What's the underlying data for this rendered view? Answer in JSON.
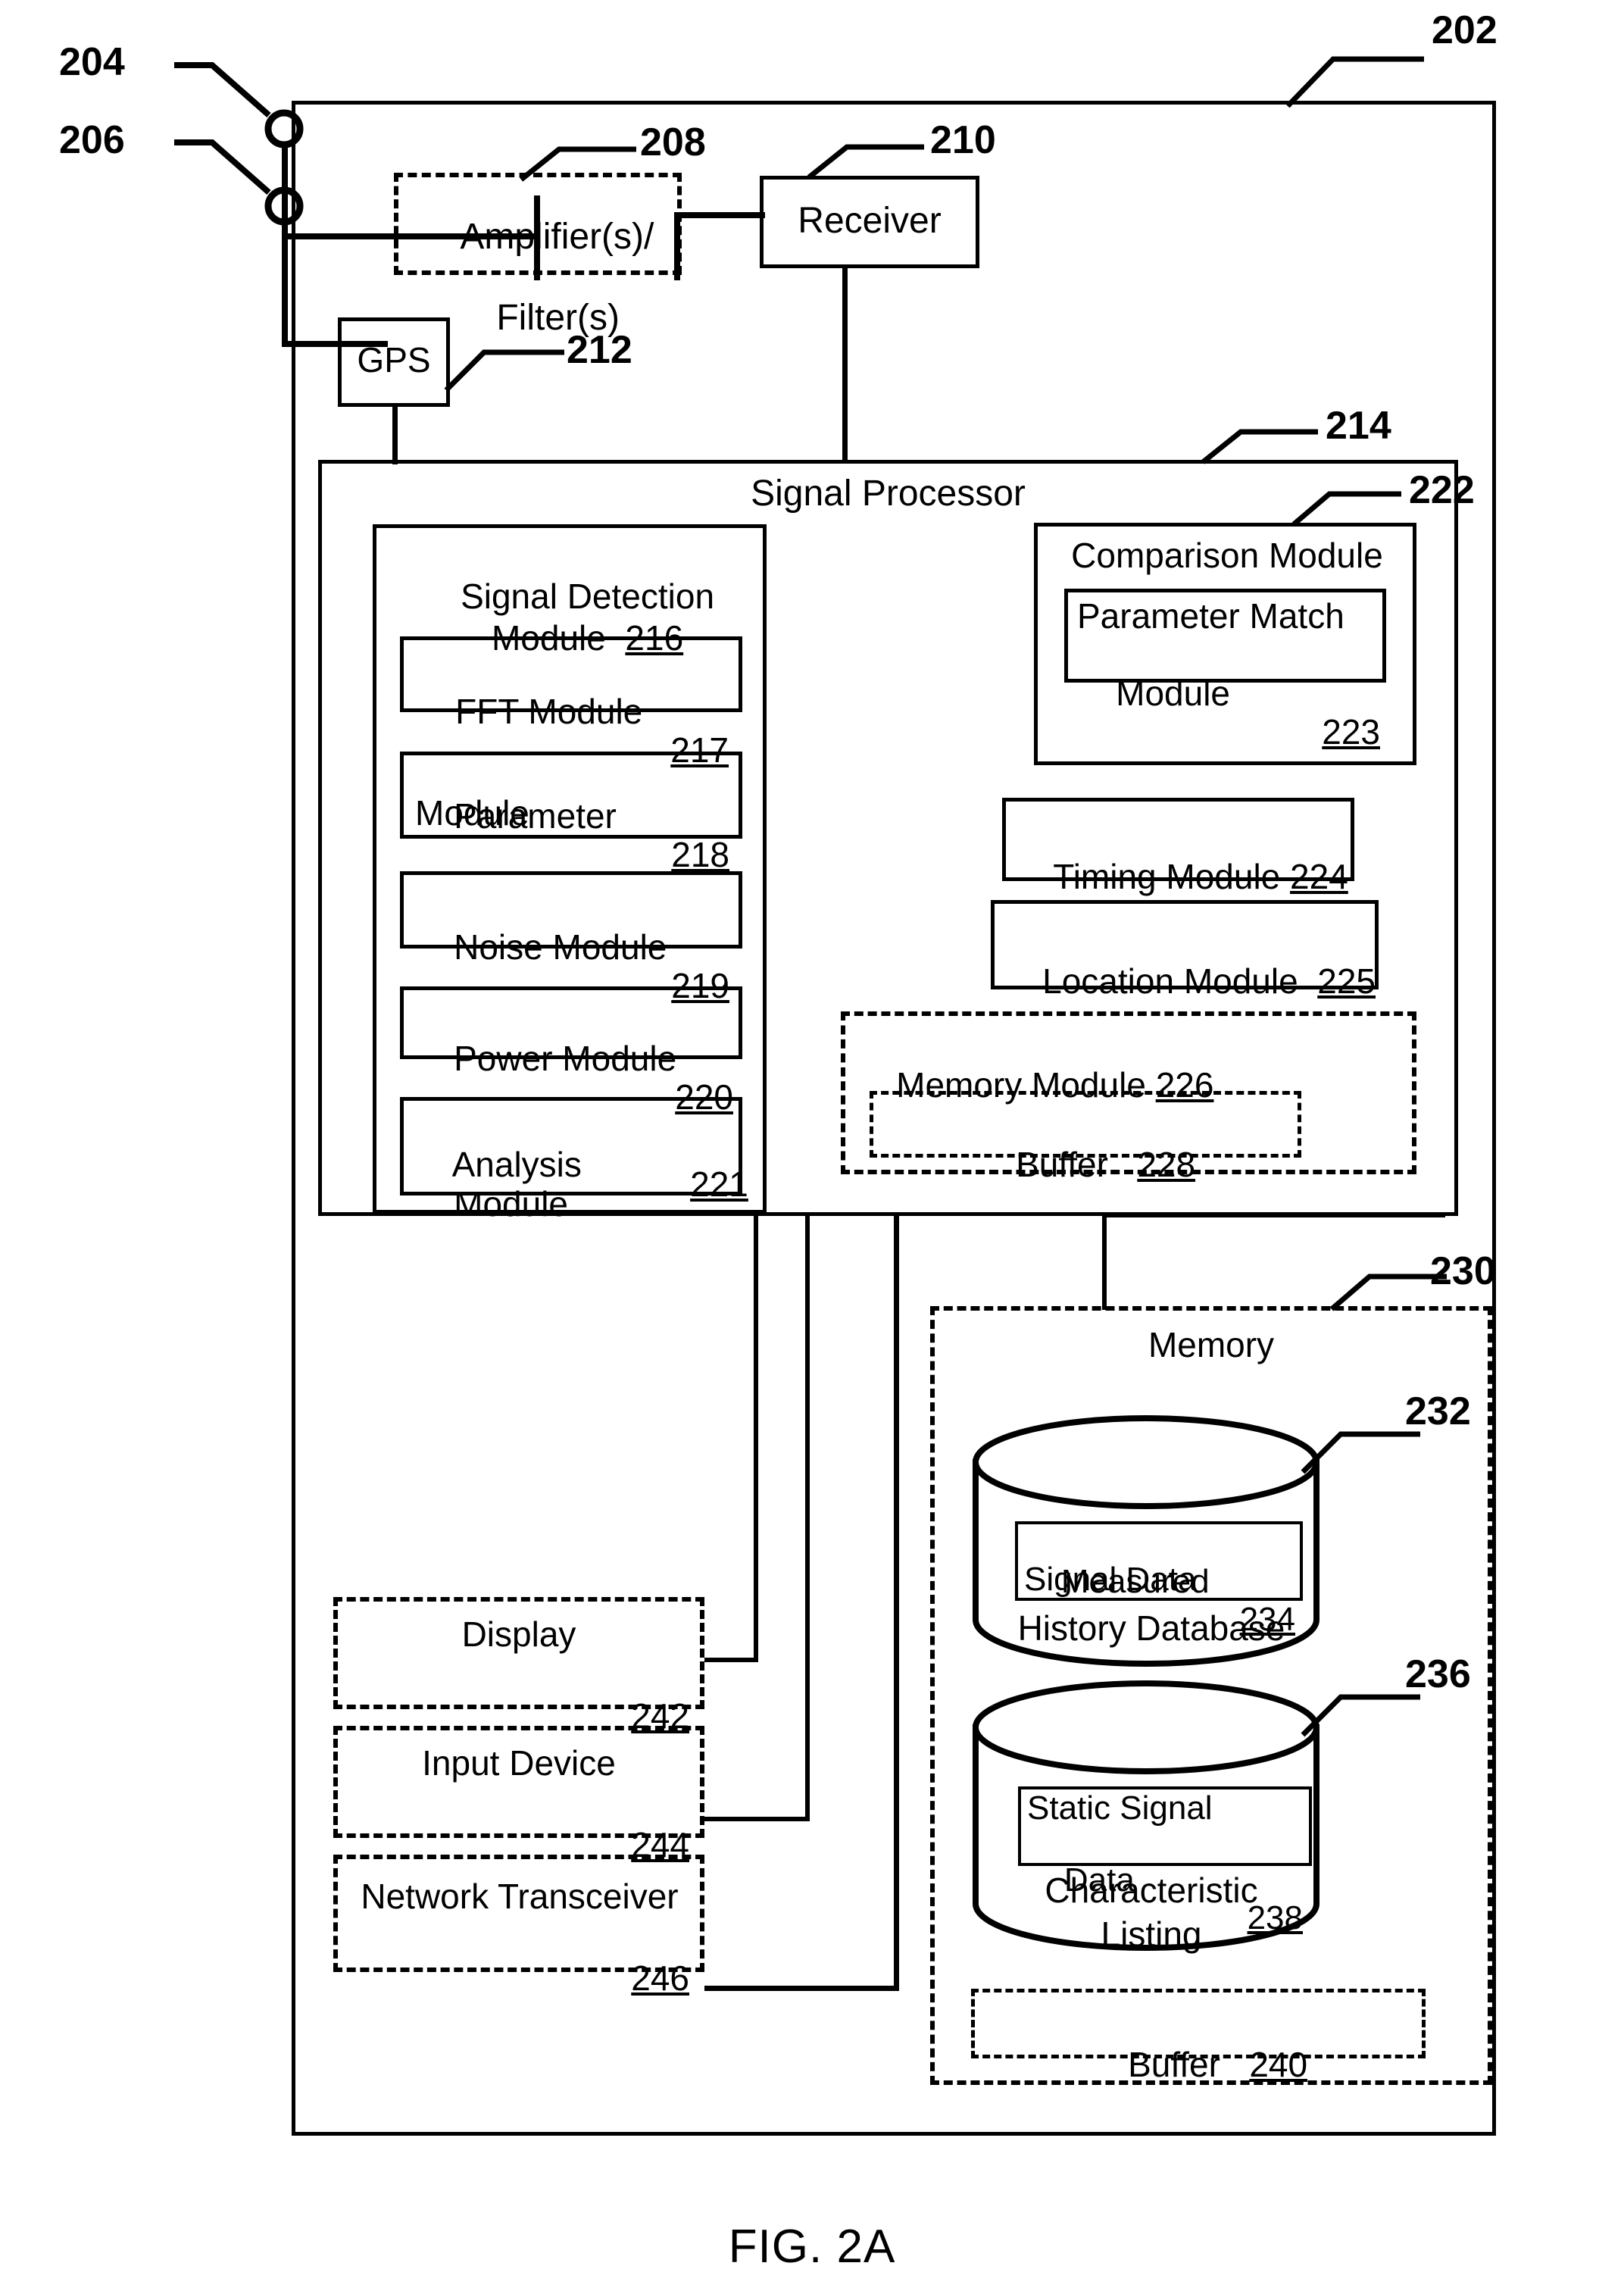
{
  "figure": {
    "caption": "FIG. 2A",
    "outer_ref": "202"
  },
  "antennas": [
    {
      "ref": "204",
      "name": "antenna-204"
    },
    {
      "ref": "206",
      "name": "antenna-206"
    }
  ],
  "front_end": {
    "amplifier_filter": {
      "line1": "Amplifier(s)/",
      "line2": "Filter(s)",
      "ref": "208",
      "style": "dashed"
    },
    "receiver": {
      "label": "Receiver",
      "ref": "210",
      "style": "solid"
    },
    "gps": {
      "label": "GPS",
      "ref": "212",
      "style": "solid"
    }
  },
  "signal_processor": {
    "label": "Signal Processor",
    "ref": "214",
    "signal_detection_module": {
      "line1": "Signal Detection",
      "line2": "Module",
      "ref": "216",
      "submodules": [
        {
          "label": "FFT Module",
          "ref": "217",
          "layout": "single"
        },
        {
          "line1": "Parameter",
          "line2": "Module",
          "ref": "218",
          "layout": "double"
        },
        {
          "label": "Noise Module",
          "ref": "219",
          "layout": "single"
        },
        {
          "label": "Power Module",
          "ref": "220",
          "layout": "single-tight"
        },
        {
          "line1": "Analysis",
          "line2": "Module",
          "ref": "221",
          "layout": "double"
        }
      ]
    },
    "comparison_module": {
      "label": "Comparison Module",
      "ref": "222",
      "parameter_match_module": {
        "line1": "Parameter Match",
        "line2": "Module",
        "ref": "223"
      }
    },
    "timing_module": {
      "label": "Timing Module",
      "ref": "224"
    },
    "location_module": {
      "label": "Location Module",
      "ref": "225"
    },
    "memory_module": {
      "label": "Memory Module",
      "ref": "226",
      "style": "dashed",
      "buffer": {
        "label": "Buffer",
        "ref": "228",
        "style": "dashed"
      }
    }
  },
  "memory": {
    "label": "Memory",
    "ref": "230",
    "style": "dashed",
    "history_database": {
      "ref": "232",
      "caption": "History Database",
      "inner": {
        "line1": "Measured",
        "line2": "Signal Data",
        "ref": "234"
      }
    },
    "characteristic_listing": {
      "ref": "236",
      "caption_line1": "Characteristic",
      "caption_line2": "Listing",
      "inner": {
        "line1": "Static Signal",
        "line2": "Data",
        "ref": "238"
      }
    },
    "buffer": {
      "label": "Buffer",
      "ref": "240",
      "style": "dashed"
    }
  },
  "peripherals": [
    {
      "label": "Display",
      "ref": "242",
      "style": "dashed",
      "name": "display-block"
    },
    {
      "label": "Input Device",
      "ref": "244",
      "style": "dashed",
      "name": "input-device-block"
    },
    {
      "label": "Network Transceiver",
      "ref": "246",
      "style": "dashed",
      "name": "network-transceiver-block"
    }
  ],
  "colors": {
    "line": "#000000",
    "background": "#ffffff"
  }
}
